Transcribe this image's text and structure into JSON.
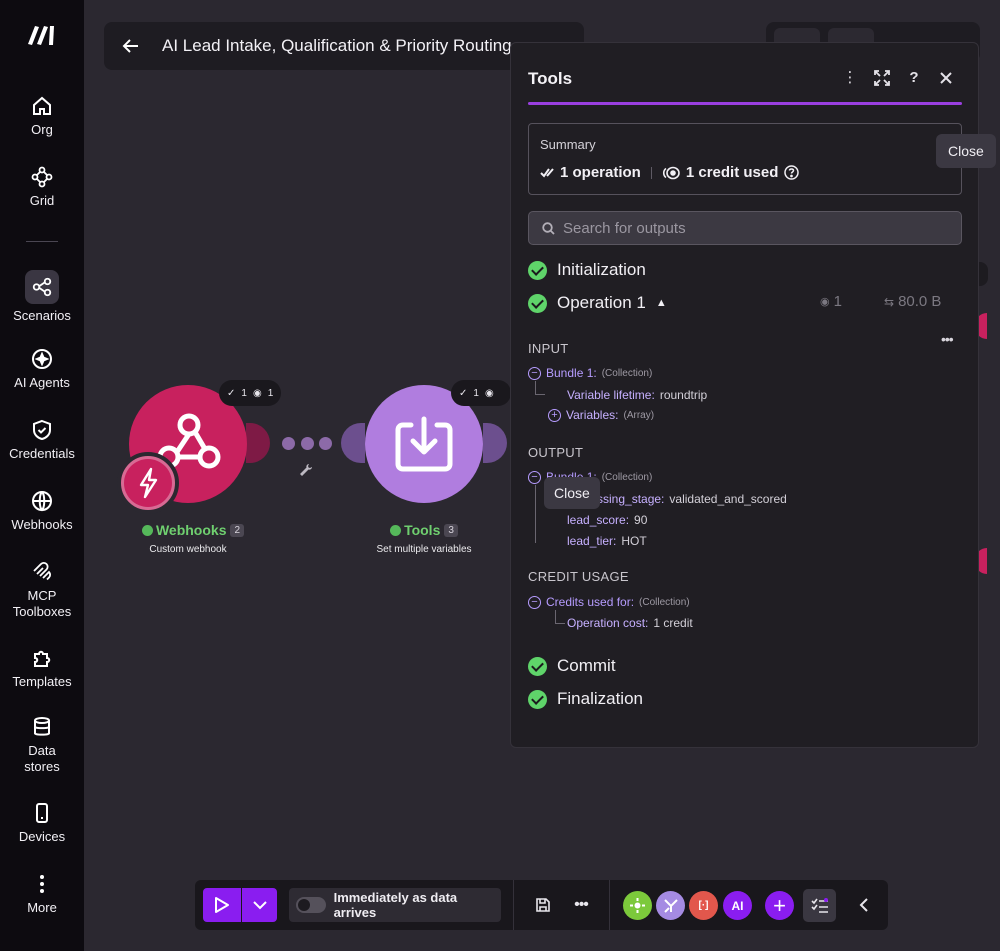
{
  "sidebar": {
    "items": [
      {
        "label": "Org",
        "icon": "home-icon"
      },
      {
        "label": "Grid",
        "icon": "grid-icon"
      },
      {
        "label": "Scenarios",
        "icon": "scenarios-icon",
        "active": true
      },
      {
        "label": "AI Agents",
        "icon": "ai-agents-icon"
      },
      {
        "label": "Credentials",
        "icon": "shield-icon"
      },
      {
        "label": "Webhooks",
        "icon": "globe-icon"
      },
      {
        "label": "MCP Toolboxes",
        "icon": "mcp-icon"
      },
      {
        "label": "Templates",
        "icon": "puzzle-icon"
      },
      {
        "label": "Data stores",
        "icon": "database-icon"
      },
      {
        "label": "Devices",
        "icon": "device-icon"
      },
      {
        "label": "More",
        "icon": "more-vertical-icon"
      }
    ]
  },
  "scenario": {
    "title": "AI Lead Intake, Qualification & Priority Routing"
  },
  "modules": {
    "webhooks": {
      "name": "Webhooks",
      "index": "2",
      "subtitle": "Custom webhook",
      "ops": "1",
      "data": "1",
      "color": "#c8215e"
    },
    "tools": {
      "name": "Tools",
      "index": "3",
      "subtitle": "Set multiple variables",
      "ops": "1",
      "data": "1",
      "color": "#b07ddf"
    }
  },
  "tooltips": {
    "close_top": "Close",
    "close_mid": "Close"
  },
  "panel": {
    "title": "Tools",
    "summary_label": "Summary",
    "operations": "1 operation",
    "credits": "1 credit used",
    "search_placeholder": "Search for outputs",
    "steps": {
      "initialization": "Initialization",
      "operation": "Operation 1",
      "commit": "Commit",
      "finalization": "Finalization"
    },
    "op_data": "1",
    "op_size": "80.0 B",
    "input": {
      "header": "INPUT",
      "bundle": "Bundle 1:",
      "bundle_type": "(Collection)",
      "lifetime_key": "Variable lifetime:",
      "lifetime_value": "roundtrip",
      "variables_key": "Variables:",
      "variables_type": "(Array)"
    },
    "output": {
      "header": "OUTPUT",
      "bundle": "Bundle 1:",
      "bundle_type": "(Collection)",
      "stage_key": "processing_stage:",
      "stage_value": "validated_and_scored",
      "score_key": "lead_score:",
      "score_value": "90",
      "tier_key": "lead_tier:",
      "tier_value": "HOT"
    },
    "credit_usage": {
      "header": "CREDIT USAGE",
      "key": "Credits used for:",
      "type": "(Collection)",
      "cost_key": "Operation cost:",
      "cost_value": "1 credit"
    }
  },
  "toolbar": {
    "schedule_label": "Immediately as data arrives",
    "apps": [
      {
        "name": "tools-app-icon",
        "color": "#7cc93b"
      },
      {
        "name": "flow-control-app-icon",
        "color": "#a58be3"
      },
      {
        "name": "text-parser-app-icon",
        "color": "#e2574c"
      },
      {
        "name": "ai-app-icon",
        "label": "AI",
        "color": "#8a1df0"
      }
    ],
    "accent": "#8a1df0"
  }
}
